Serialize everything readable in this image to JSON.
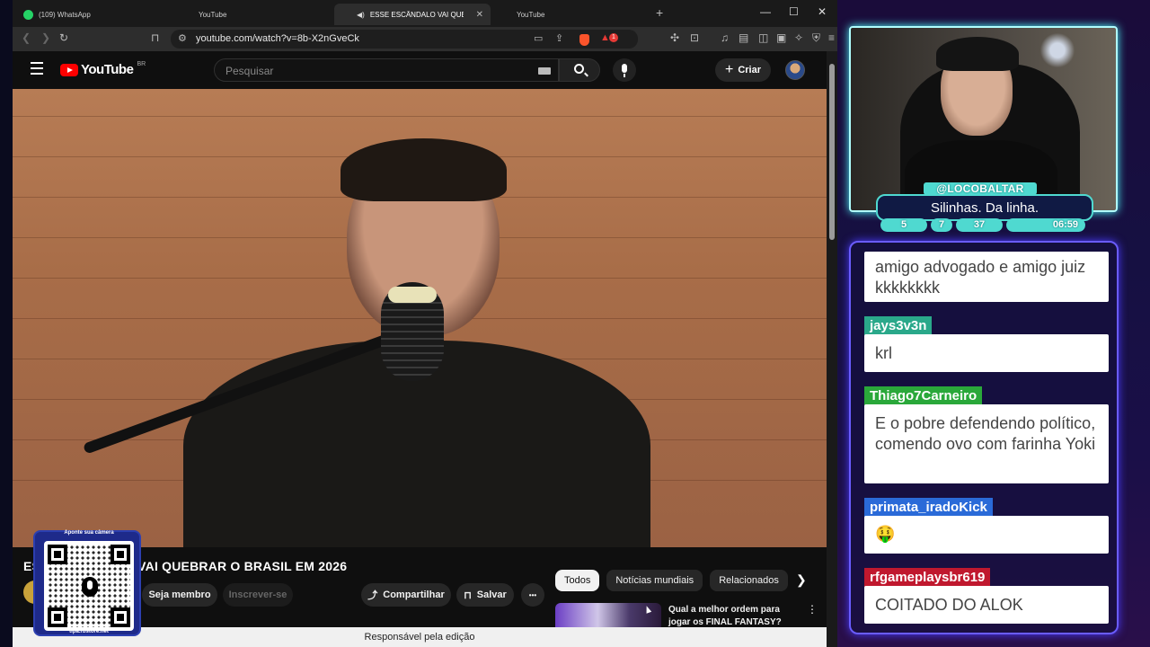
{
  "browser": {
    "tabs": [
      {
        "title": "(109) WhatsApp",
        "icon": "whatsapp-icon"
      },
      {
        "title": "YouTube",
        "icon": "youtube-icon"
      },
      {
        "title": "ESSE ESCÂNDALO VAI QUEBRAR O",
        "icon": "youtube-icon",
        "active": true
      },
      {
        "title": "YouTube",
        "icon": "youtube-icon"
      }
    ],
    "url": "youtube.com/watch?v=8b-X2nGveCk",
    "brave_badge": "1"
  },
  "youtube": {
    "logo_text": "YouTube",
    "country_code": "BR",
    "search_placeholder": "Pesquisar",
    "create_label": "Criar",
    "video_title_prefix": "ES",
    "video_title": "VAI QUEBRAR O BRASIL EM 2026",
    "join_label": "Seja membro",
    "subscribe_label": "Inscrever-se",
    "share_label": "Compartilhar",
    "save_label": "Salvar",
    "more_label": "•••",
    "chips": [
      "Todos",
      "Notícias mundiais",
      "Relacionados"
    ],
    "recommended_title": "Qual a melhor ordem para jogar os FINAL FANTASY?",
    "status_text": "Responsável pela edição"
  },
  "qr": {
    "top_label": "Aponte sua câmera",
    "bottom_label": "tipa.rbstore.net"
  },
  "stream": {
    "streamer_tag": "@LOCOBALTAR",
    "overlay_message": "Silinhas. Da linha.",
    "stats": [
      "5",
      "7",
      "37",
      "06:59"
    ],
    "accent_color": "#4fd9d0"
  },
  "chat": {
    "messages": [
      {
        "user": "",
        "text": "amigo advogado e amigo juiz kkkkkkkk",
        "color": ""
      },
      {
        "user": "jays3v3n",
        "text": "krl",
        "color": "#2aa88a"
      },
      {
        "user": "Thiago7Carneiro",
        "text": "E o pobre defendendo político, comendo ovo com farinha Yoki",
        "color": "#2aa83a"
      },
      {
        "user": "primata_iradoKick",
        "text": "🤑",
        "color": "#2a6ad8"
      },
      {
        "user": "rfgameplaysbr619",
        "text": "COITADO DO ALOK",
        "color": "#c0182e"
      }
    ]
  }
}
